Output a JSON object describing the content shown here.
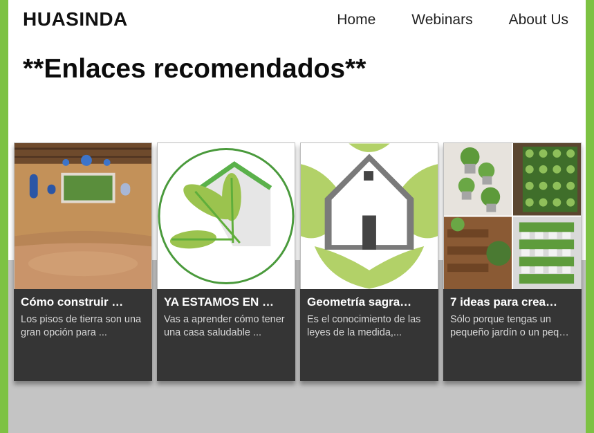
{
  "header": {
    "brand": "HUASINDA",
    "nav": [
      {
        "label": "Home"
      },
      {
        "label": "Webinars"
      },
      {
        "label": "About Us"
      }
    ]
  },
  "page_title": "**Enlaces recomendados**",
  "cards": [
    {
      "title": "Cómo construir …",
      "description": "Los pisos de tierra son una gran opción para ...",
      "image": "adobe-room-interior"
    },
    {
      "title": "YA ESTAMOS EN …",
      "description": "Vas a aprender cómo tener una casa saludable ...",
      "image": "green-house-leaves-logo"
    },
    {
      "title": "Geometría sagra…",
      "description": "Es el conocimiento de las leyes de la medida,...",
      "image": "house-leaf-logo"
    },
    {
      "title": "7 ideas para crea…",
      "description": "Sólo porque tengas un pequeño jardín o un peq…",
      "image": "vertical-garden-collage"
    }
  ],
  "colors": {
    "accent": "#7dc243",
    "card_bg": "#353535",
    "band_gray": "#c4c4c4"
  }
}
